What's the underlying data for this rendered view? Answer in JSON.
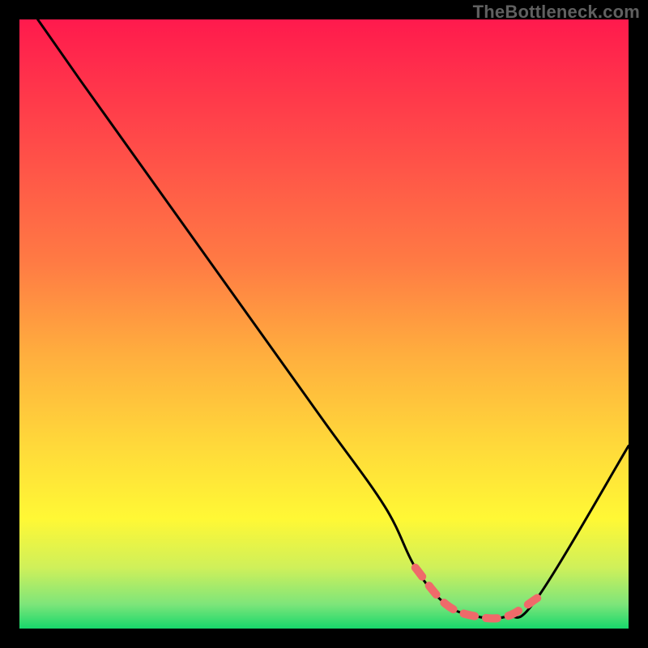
{
  "watermark": "TheBottleneck.com",
  "chart_data": {
    "type": "line",
    "title": "",
    "xlabel": "",
    "ylabel": "",
    "xlim": [
      0,
      100
    ],
    "ylim": [
      0,
      100
    ],
    "grid": false,
    "series": [
      {
        "name": "curve",
        "color": "#000000",
        "x": [
          3,
          10,
          20,
          30,
          40,
          50,
          60,
          65,
          70,
          75,
          80,
          85,
          100
        ],
        "y": [
          100,
          90,
          76,
          62,
          48,
          34,
          20,
          10,
          4,
          2,
          2,
          5,
          30
        ]
      },
      {
        "name": "highlight",
        "color": "#ef6a6a",
        "x": [
          65,
          70,
          75,
          80,
          85
        ],
        "y": [
          10,
          4,
          2,
          2,
          5
        ]
      }
    ],
    "gradient_stops": [
      {
        "offset": 0.0,
        "color": "#ff1a4d"
      },
      {
        "offset": 0.2,
        "color": "#ff4a49"
      },
      {
        "offset": 0.4,
        "color": "#ff7b44"
      },
      {
        "offset": 0.55,
        "color": "#ffae3e"
      },
      {
        "offset": 0.7,
        "color": "#ffd93a"
      },
      {
        "offset": 0.82,
        "color": "#fff835"
      },
      {
        "offset": 0.9,
        "color": "#cff05a"
      },
      {
        "offset": 0.96,
        "color": "#7ee57a"
      },
      {
        "offset": 1.0,
        "color": "#17d86b"
      }
    ]
  }
}
